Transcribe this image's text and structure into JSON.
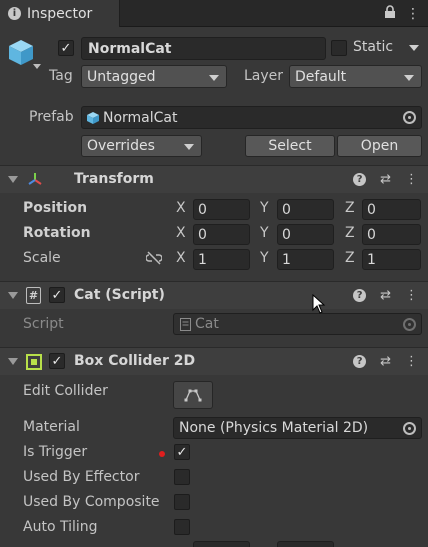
{
  "tab": {
    "title": "Inspector"
  },
  "object": {
    "name": "NormalCat",
    "static_label": "Static",
    "tag_label": "Tag",
    "tag_value": "Untagged",
    "layer_label": "Layer",
    "layer_value": "Default",
    "prefab_label": "Prefab",
    "prefab_value": "NormalCat",
    "overrides_label": "Overrides",
    "select_label": "Select",
    "open_label": "Open"
  },
  "transform": {
    "title": "Transform",
    "position_label": "Position",
    "rotation_label": "Rotation",
    "scale_label": "Scale",
    "x": "X",
    "y": "Y",
    "z": "Z",
    "position": [
      "0",
      "0",
      "0"
    ],
    "rotation": [
      "0",
      "0",
      "0"
    ],
    "scale": [
      "1",
      "1",
      "1"
    ]
  },
  "cat_script": {
    "title": "Cat (Script)",
    "script_label": "Script",
    "script_value": "Cat"
  },
  "box_collider": {
    "title": "Box Collider 2D",
    "edit_collider_label": "Edit Collider",
    "material_label": "Material",
    "material_value": "None (Physics Material 2D)",
    "is_trigger_label": "Is Trigger",
    "used_by_effector_label": "Used By Effector",
    "used_by_composite_label": "Used By Composite",
    "auto_tiling_label": "Auto Tiling"
  },
  "colors": {
    "background": "#383838",
    "field": "#2a2a2a",
    "cube_icon": "#6fc3ea",
    "collider_icon": "#b8e04a",
    "override_dot": "#e01e1e"
  }
}
